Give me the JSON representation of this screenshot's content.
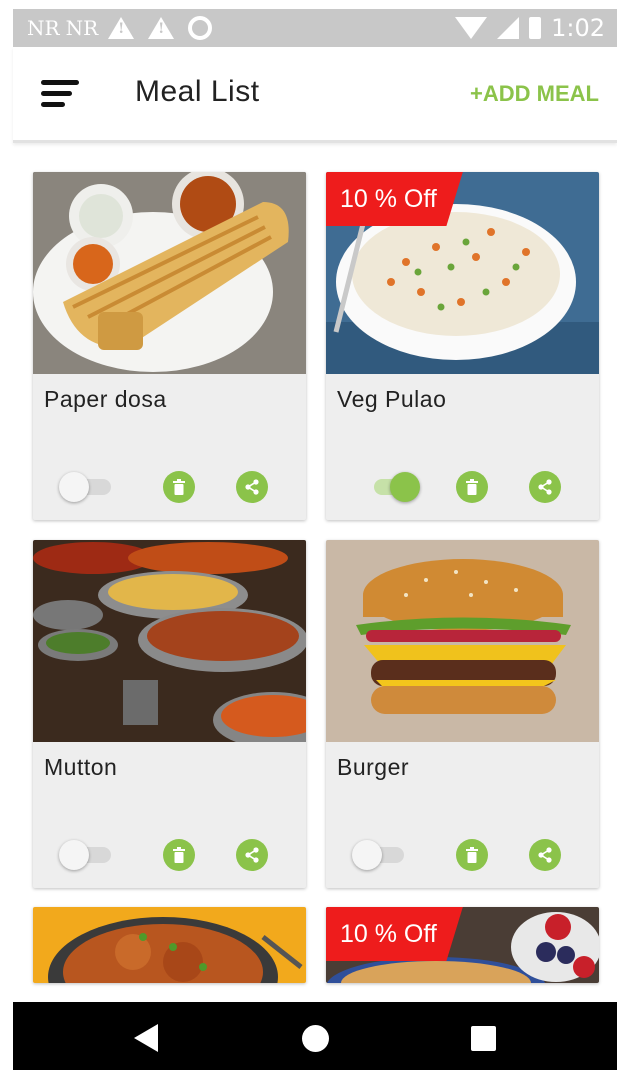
{
  "status_bar": {
    "carrier_1": "NR",
    "carrier_2": "NR",
    "icons": [
      "warning-icon",
      "warning-icon",
      "circle-icon",
      "wifi-icon",
      "signal-icon",
      "battery-icon"
    ],
    "time": "1:02"
  },
  "app_bar": {
    "title": "Meal List",
    "add_label": "+ADD MEAL",
    "menu_icon": "menu-icon"
  },
  "theme": {
    "accent": "#8bc34a",
    "badge_red": "#ee1c1c",
    "card_bg": "#eeeeee",
    "status_bar_bg": "#c8c8c8"
  },
  "meals": [
    {
      "name": "Paper dosa",
      "badge": "",
      "enabled": false
    },
    {
      "name": "Veg Pulao",
      "badge": "10 % Off",
      "enabled": true
    },
    {
      "name": "Mutton",
      "badge": "",
      "enabled": false
    },
    {
      "name": "Burger",
      "badge": "",
      "enabled": false
    },
    {
      "name": "",
      "badge": ""
    },
    {
      "name": "",
      "badge": "10 % Off"
    }
  ],
  "actions": {
    "delete_icon": "trash-icon",
    "share_icon": "share-icon"
  },
  "nav_bar": {
    "icons": [
      "back-icon",
      "home-icon",
      "recents-icon"
    ]
  }
}
